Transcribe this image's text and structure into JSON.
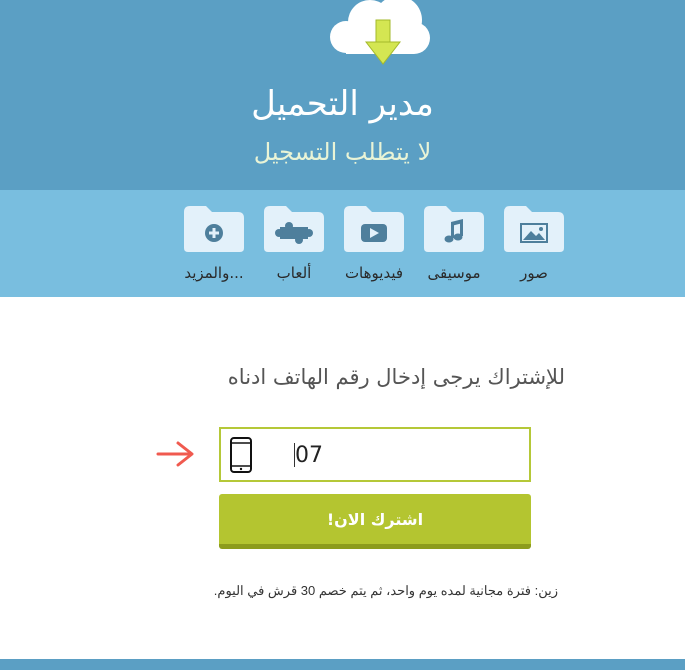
{
  "header": {
    "title": "مدير التحميل",
    "subtitle": "لا يتطلب التسجيل",
    "logo_icon": "cloud-download-icon"
  },
  "categories": [
    {
      "label": "صور",
      "icon": "image-icon"
    },
    {
      "label": "موسيقى",
      "icon": "music-note-icon"
    },
    {
      "label": "فيديوهات",
      "icon": "play-icon"
    },
    {
      "label": "ألعاب",
      "icon": "puzzle-icon"
    },
    {
      "label": "والمزيد...",
      "icon": "plus-circle-icon"
    }
  ],
  "form": {
    "instruction": "للإشتراك يرجى إدخال رقم الهاتف ادناه",
    "phone_value": "07",
    "phone_icon": "mobile-phone-icon",
    "pointer_icon": "arrow-right-icon",
    "subscribe_label": "اشترك الان!",
    "disclaimer": "زين: فترة مجانية لمده يوم واحد، ثم يتم خصم 30 قرش في اليوم."
  },
  "colors": {
    "header_bg": "#5b9fc4",
    "category_band_bg": "#79bedf",
    "folder": "#e3f1fa",
    "accent_green": "#b4c530",
    "arrow_red": "#f05a4f"
  }
}
